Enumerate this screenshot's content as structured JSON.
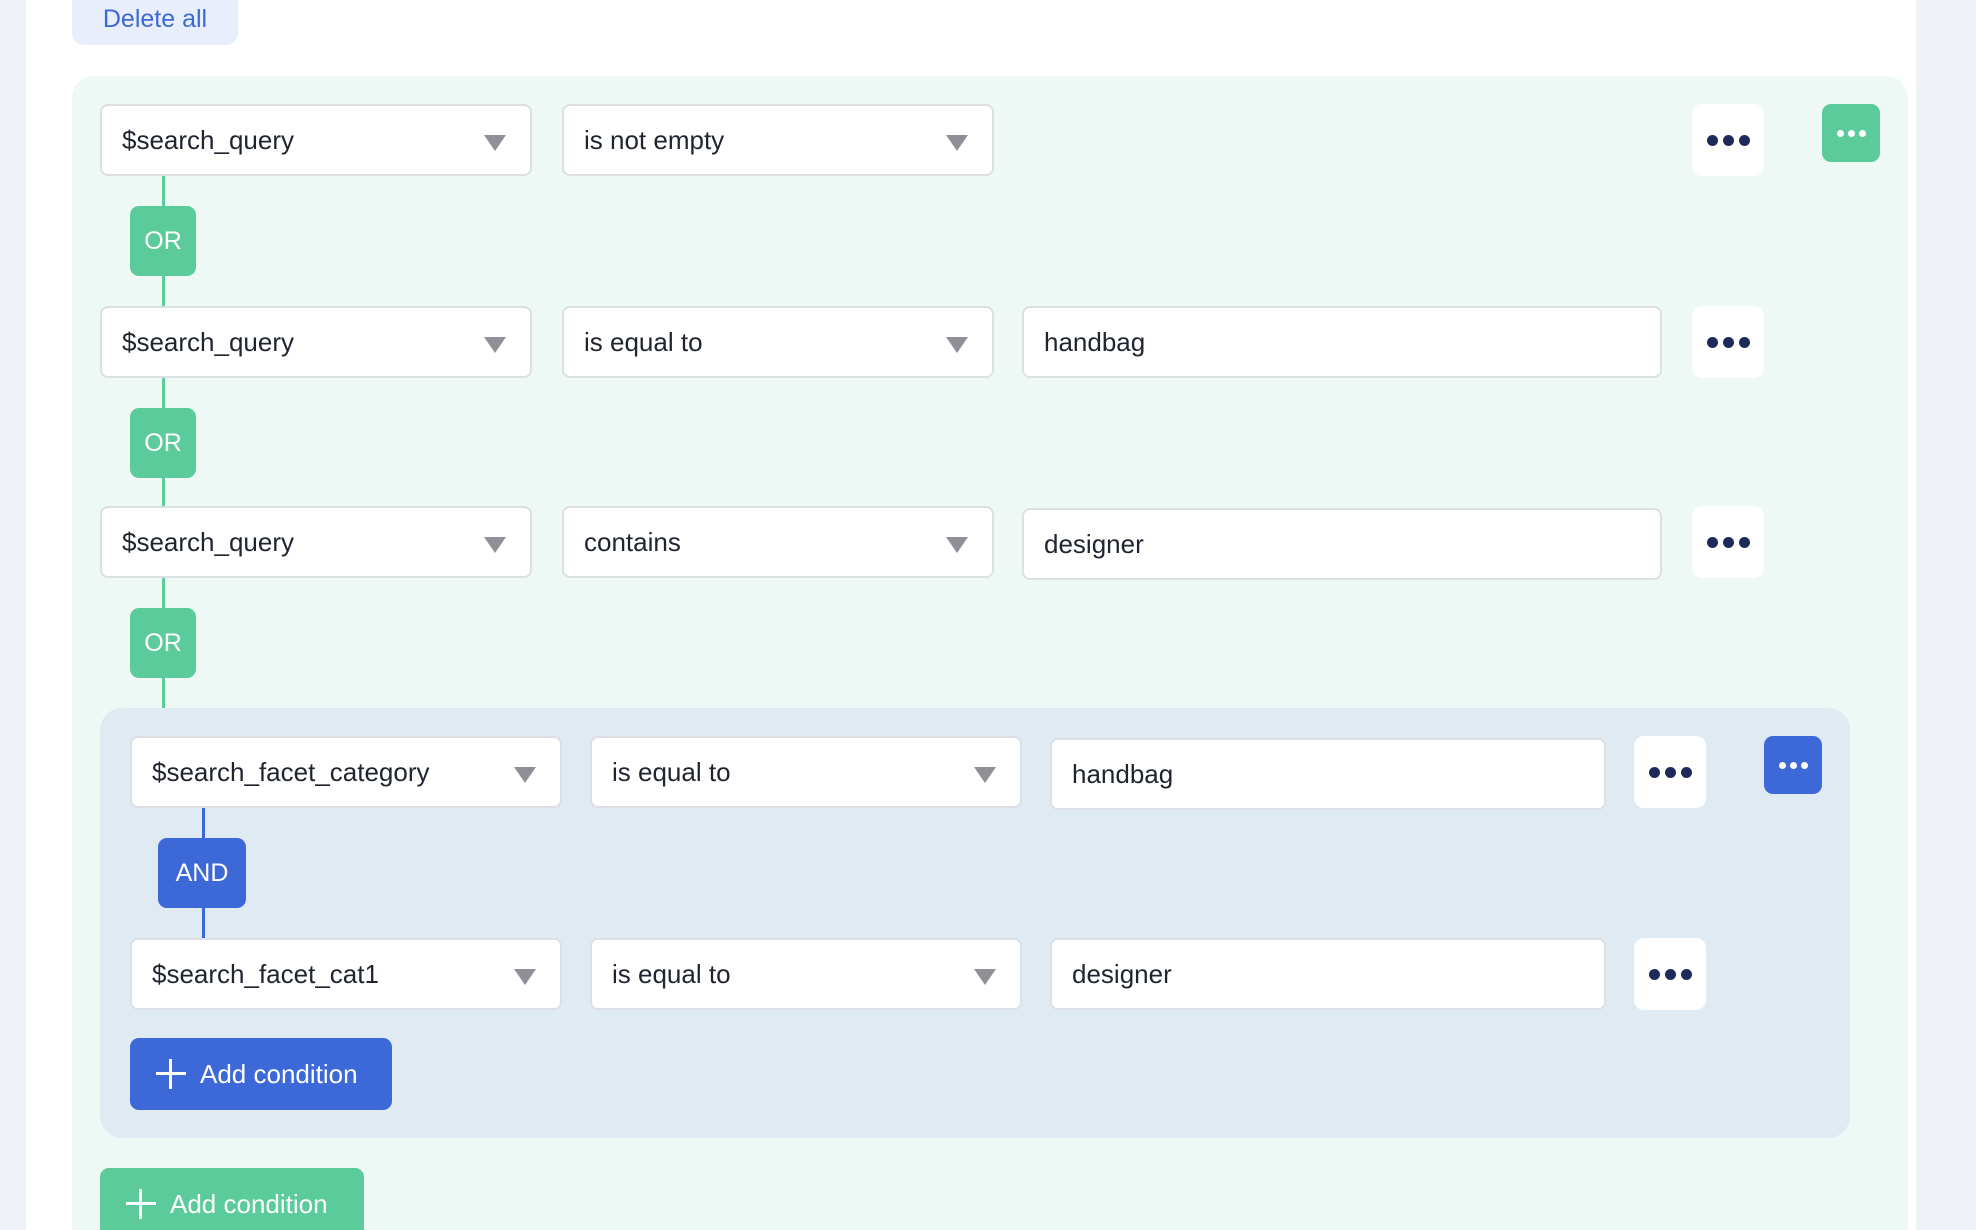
{
  "toolbar": {
    "delete_all_label": "Delete all"
  },
  "colors": {
    "green_accent": "#5ccb9b",
    "blue_accent": "#3d68d8",
    "dots": "#1e2a5a"
  },
  "group_or": {
    "operator": "OR",
    "conditions": [
      {
        "field": "$search_query",
        "operator": "is not empty",
        "value": ""
      },
      {
        "field": "$search_query",
        "operator": "is equal to",
        "value": "handbag"
      },
      {
        "field": "$search_query",
        "operator": "contains",
        "value": "designer"
      }
    ],
    "add_condition_label": "Add condition"
  },
  "group_and": {
    "operator": "AND",
    "conditions": [
      {
        "field": "$search_facet_category",
        "operator": "is equal to",
        "value": "handbag"
      },
      {
        "field": "$search_facet_cat1",
        "operator": "is equal to",
        "value": "designer"
      }
    ],
    "add_condition_label": "Add condition"
  },
  "icons": {
    "more": "more-dots-icon",
    "plus": "plus-icon",
    "caret": "caret-down-icon"
  }
}
